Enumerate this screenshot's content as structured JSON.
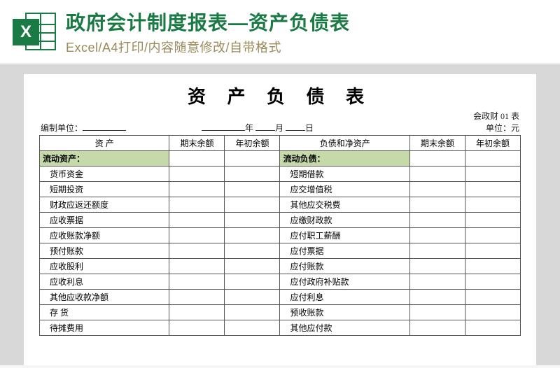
{
  "header": {
    "badge_letter": "X",
    "title": "政府会计制度报表—资产负债表",
    "subtitle": "Excel/A4打印/内容随意修改/自带格式"
  },
  "sheet": {
    "title": "资 产 负 债 表",
    "form_code": "会政财 01 表",
    "org_label": "编制单位：",
    "date_year_suffix": "年",
    "date_month_suffix": "月",
    "date_day_suffix": "日",
    "unit_label": "单位：元"
  },
  "columns": {
    "assets_header": "资  产",
    "period_end": "期末余额",
    "year_begin": "年初余额",
    "liab_header": "负债和净资产"
  },
  "rows": [
    {
      "left_label": "流动资产：",
      "left_section": true,
      "right_label": "流动负债：",
      "right_section": true
    },
    {
      "left_label": "货币资金",
      "right_label": "短期借款"
    },
    {
      "left_label": "短期投资",
      "right_label": "应交增值税"
    },
    {
      "left_label": "财政应返还额度",
      "right_label": "其他应交税费"
    },
    {
      "left_label": "应收票据",
      "right_label": "应缴财政款"
    },
    {
      "left_label": "应收账款净额",
      "right_label": "应付职工薪酬"
    },
    {
      "left_label": "预付账款",
      "right_label": "应付票据"
    },
    {
      "left_label": "应收股利",
      "right_label": "应付账款"
    },
    {
      "left_label": "应收利息",
      "right_label": "应付政府补贴款"
    },
    {
      "left_label": "其他应收款净额",
      "right_label": "应付利息"
    },
    {
      "left_label": "存  货",
      "right_label": "预收账款"
    },
    {
      "left_label": "待摊费用",
      "right_label": "其他应付款"
    }
  ]
}
